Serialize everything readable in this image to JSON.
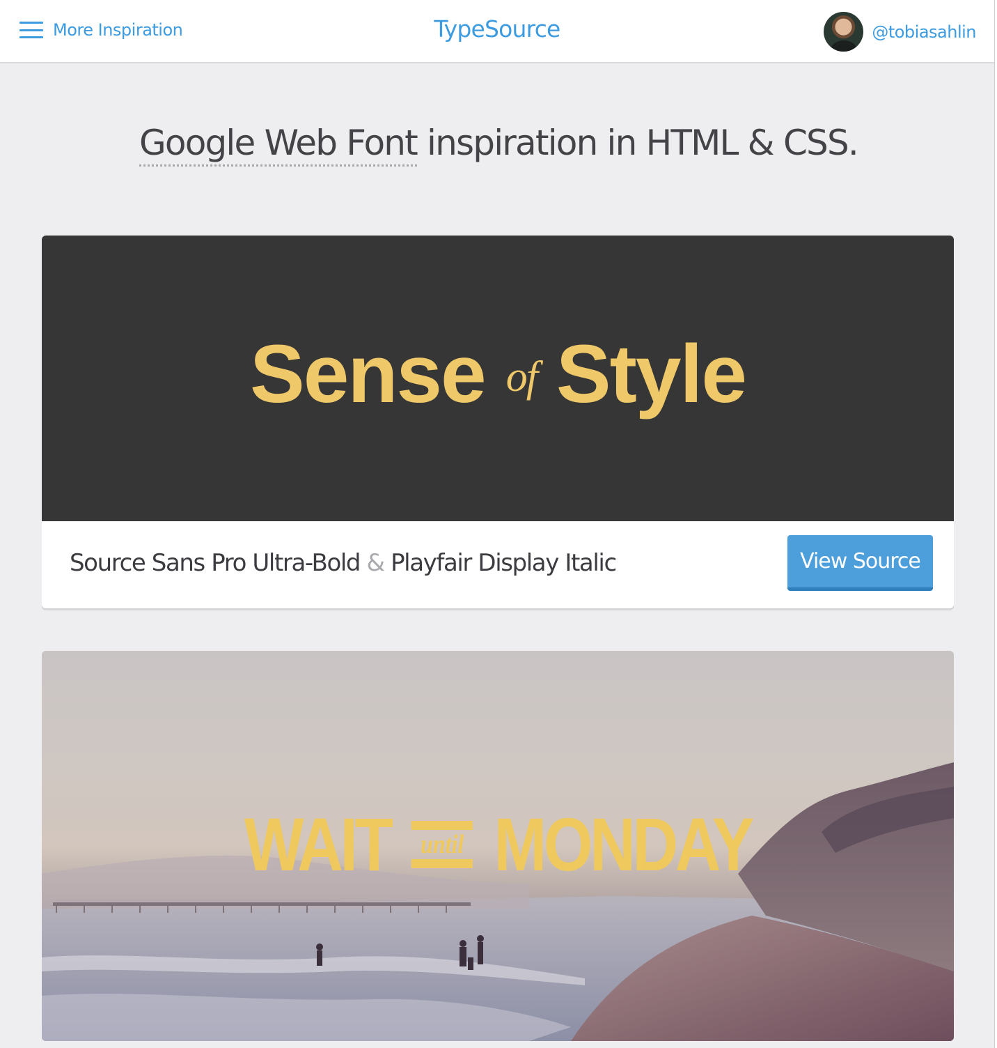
{
  "header": {
    "menu_label": "More Inspiration",
    "brand": "TypeSource",
    "username": "@tobiasahlin"
  },
  "headline": {
    "highlight": "Google Web Font",
    "rest": " inspiration in HTML & CSS."
  },
  "cards": [
    {
      "hero_word_1": "Sense",
      "hero_connector": "of",
      "hero_word_2": "Style",
      "font_primary": "Source Sans Pro Ultra-Bold",
      "font_separator": "&",
      "font_secondary": "Playfair Display Italic",
      "button_label": "View Source"
    },
    {
      "hero_word_1": "WAIT",
      "hero_connector": "until",
      "hero_word_2": "MONDAY"
    }
  ],
  "colors": {
    "accent": "#3d9be0",
    "hero_text": "#efc869",
    "hero_bg": "#363636",
    "page_bg": "#eeeef0"
  }
}
